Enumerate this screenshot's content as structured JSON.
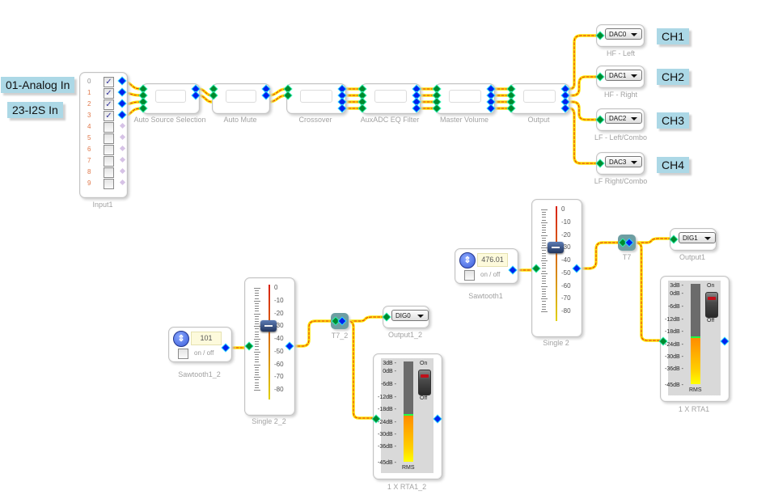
{
  "labels": {
    "analog_in": "01-Analog In",
    "i2s_in": "23-I2S In",
    "ch1": "CH1",
    "ch2": "CH2",
    "ch3": "CH3",
    "ch4": "CH4"
  },
  "input_block": {
    "name": "Input1",
    "channels": [
      {
        "num": "0",
        "checked": true
      },
      {
        "num": "1",
        "checked": true
      },
      {
        "num": "2",
        "checked": true
      },
      {
        "num": "3",
        "checked": true
      },
      {
        "num": "4",
        "checked": false
      },
      {
        "num": "5",
        "checked": false
      },
      {
        "num": "6",
        "checked": false
      },
      {
        "num": "7",
        "checked": false
      },
      {
        "num": "8",
        "checked": false
      },
      {
        "num": "9",
        "checked": false
      }
    ],
    "check_glyph": "✓"
  },
  "chain": [
    {
      "name": "Auto Source Selection",
      "inputs": 4,
      "outputs": 2
    },
    {
      "name": "Auto Mute",
      "inputs": 2,
      "outputs": 2
    },
    {
      "name": "Crossover",
      "inputs": 2,
      "outputs": 4
    },
    {
      "name": "AuxADC EQ Filter",
      "inputs": 4,
      "outputs": 4
    },
    {
      "name": "Master Volume",
      "inputs": 4,
      "outputs": 4
    },
    {
      "name": "Output",
      "inputs": 4,
      "outputs": 4
    }
  ],
  "dac_outputs": [
    {
      "value": "DAC0",
      "name": "HF - Left"
    },
    {
      "value": "DAC1",
      "name": "HF - Right"
    },
    {
      "value": "DAC2",
      "name": "LF - Left/Combo"
    },
    {
      "value": "DAC3",
      "name": "LF Right/Combo"
    }
  ],
  "sawtooth_1_2": {
    "name": "Sawtooth1_2",
    "value": "101",
    "toggle_label": "on / off",
    "enabled": false,
    "icon": "⇕"
  },
  "sawtooth_1": {
    "name": "Sawtooth1",
    "value": "476.01",
    "toggle_label": "on / off",
    "enabled": false,
    "icon": "⇕"
  },
  "fader_single_2_2": {
    "name": "Single 2_2",
    "scale": [
      "0",
      "-10",
      "-20",
      "-30",
      "-40",
      "-50",
      "-60",
      "-70",
      "-80"
    ],
    "value_db": -30
  },
  "fader_single_2": {
    "name": "Single 2",
    "scale": [
      "0",
      "-10",
      "-20",
      "-30",
      "-40",
      "-50",
      "-60",
      "-70",
      "-80"
    ],
    "value_db": -30
  },
  "splitter_t7_2": {
    "name": "T7_2"
  },
  "splitter_t7": {
    "name": "T7"
  },
  "dig_output_1_2": {
    "value": "DIG0",
    "name": "Output1_2"
  },
  "dig_output_1": {
    "value": "DIG1",
    "name": "Output1"
  },
  "rta_1_2": {
    "name": "1 X RTA1_2",
    "scale": [
      "3dB -",
      "0dB -",
      "-6dB -",
      "-12dB -",
      "-18dB -",
      "-24dB -",
      "-30dB -",
      "-36dB -",
      "-45dB -"
    ],
    "level_db": -23,
    "switch_on": "On",
    "switch_off": "Off",
    "mode": "RMS"
  },
  "rta_1": {
    "name": "1 X RTA1",
    "scale": [
      "3dB -",
      "0dB -",
      "-6dB -",
      "-12dB -",
      "-18dB -",
      "-24dB -",
      "-30dB -",
      "-36dB -",
      "-45dB -"
    ],
    "level_db": -23,
    "switch_on": "On",
    "switch_off": "Off",
    "mode": "RMS"
  },
  "colors": {
    "wire_outer": "#ffe600",
    "wire_inner": "#e0241a",
    "pin_input": "#008a2e",
    "pin_output": "#0022ee",
    "label_bg": "#acd8e6",
    "splitter": "#6d9ea2"
  }
}
